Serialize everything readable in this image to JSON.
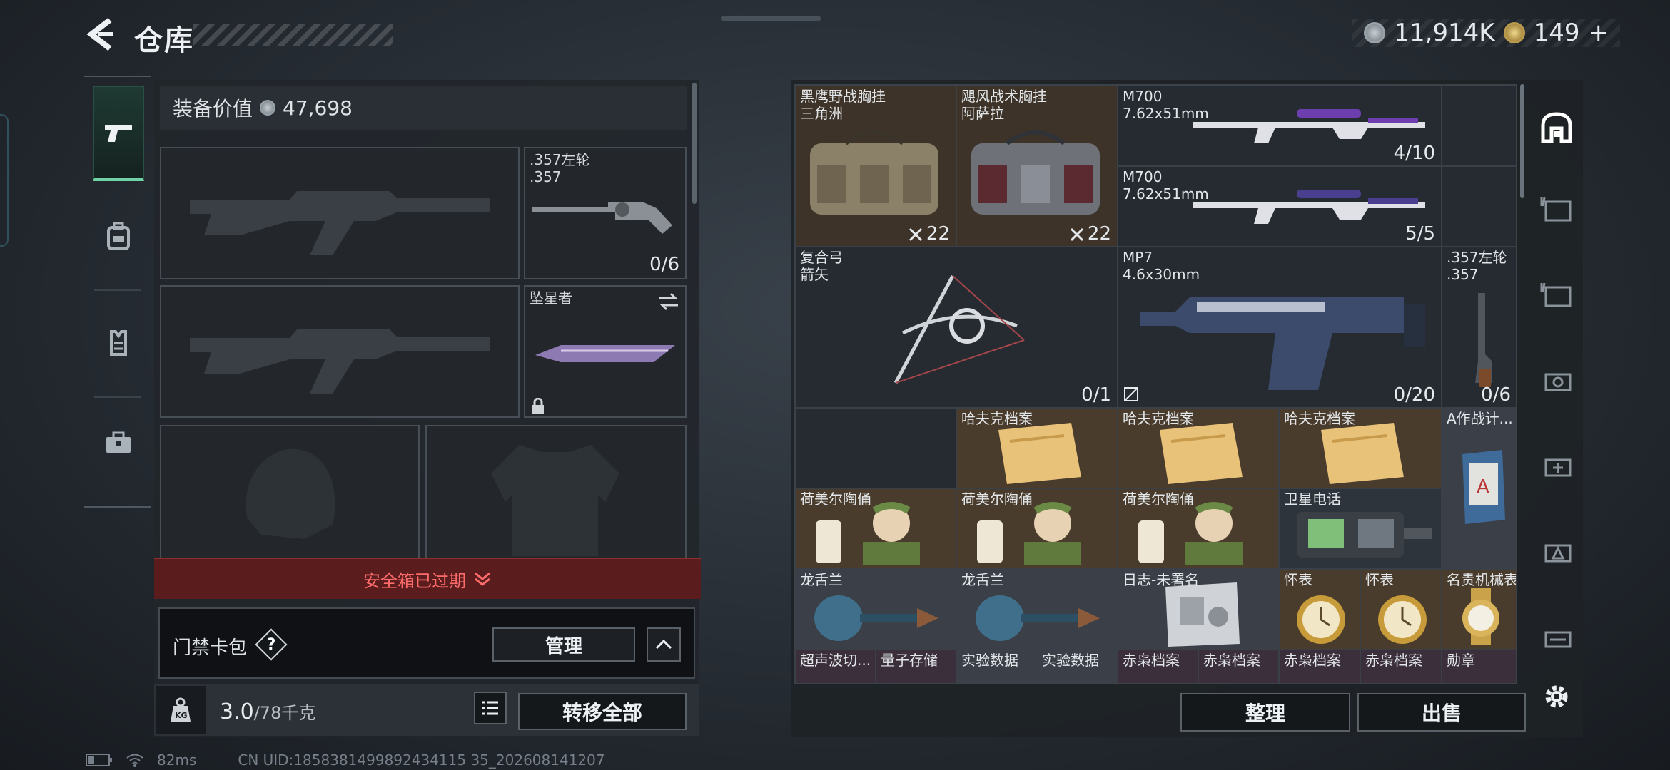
{
  "header": {
    "title": "仓库",
    "coins": "11,914K",
    "tickets": "149",
    "plus": "+"
  },
  "left_panel": {
    "equipment_value_label": "装备价值",
    "equipment_value": "47,698",
    "secondary_slot": {
      "line1": ".357左轮",
      "line2": ".357",
      "count": "0/6"
    },
    "melee_slot": {
      "name": "坠星者"
    },
    "safebox_status": "安全箱已过期",
    "keycard": {
      "label": "门禁卡包",
      "help": "?",
      "manage": "管理"
    },
    "weight": {
      "current": "3.0",
      "max": "/78千克"
    },
    "transfer_all": "转移全部"
  },
  "grid": {
    "cells": [
      {
        "id": "rig1",
        "line1": "黑鹰野战胸挂",
        "line2": "三角洲",
        "count": "22"
      },
      {
        "id": "rig2",
        "line1": "飓风战术胸挂",
        "line2": "阿萨拉",
        "count": "22"
      },
      {
        "id": "m700a",
        "line1": "M700",
        "line2": "7.62x51mm",
        "count": "4/10"
      },
      {
        "id": "m700b",
        "line1": "M700",
        "line2": "7.62x51mm",
        "count": "5/5"
      },
      {
        "id": "bow",
        "line1": "复合弓",
        "line2": "箭矢",
        "count": "0/1"
      },
      {
        "id": "mp7",
        "line1": "MP7",
        "line2": "4.6x30mm",
        "count": "0/20"
      },
      {
        "id": "rev",
        "line1": ".357左轮",
        "line2": ".357",
        "count": "0/6"
      },
      {
        "id": "haf1",
        "line1": "哈夫克档案"
      },
      {
        "id": "haf2",
        "line1": "哈夫克档案"
      },
      {
        "id": "haf3",
        "line1": "哈夫克档案"
      },
      {
        "id": "plan",
        "line1": "A作战计..."
      },
      {
        "id": "fig1",
        "line1": "荷美尔陶俑"
      },
      {
        "id": "fig2",
        "line1": "荷美尔陶俑"
      },
      {
        "id": "fig3",
        "line1": "荷美尔陶俑"
      },
      {
        "id": "phone",
        "line1": "卫星电话"
      },
      {
        "id": "tongue1",
        "line1": "龙舌兰"
      },
      {
        "id": "tongue2",
        "line1": "龙舌兰"
      },
      {
        "id": "log",
        "line1": "日志-未署名"
      },
      {
        "id": "watch1",
        "line1": "怀表"
      },
      {
        "id": "watch2",
        "line1": "怀表"
      },
      {
        "id": "watch3",
        "line1": "名贵机械表"
      },
      {
        "id": "r1",
        "line1": "超声波切..."
      },
      {
        "id": "r2",
        "line1": "量子存储"
      },
      {
        "id": "r3",
        "line1": "实验数据"
      },
      {
        "id": "r4",
        "line1": "实验数据"
      },
      {
        "id": "r5",
        "line1": "赤枭档案"
      },
      {
        "id": "r6",
        "line1": "赤枭档案"
      },
      {
        "id": "r7",
        "line1": "赤枭档案"
      },
      {
        "id": "r8",
        "line1": "赤枭档案"
      },
      {
        "id": "r9",
        "line1": "勋章"
      }
    ],
    "sort_button": "整理",
    "sell_button": "出售"
  },
  "status_bar": {
    "ping": "82ms",
    "uid": "CN UID:1858381499892434115 35_202608141207"
  },
  "colors": {
    "expired_text": "#ff6c6c",
    "active_tab": "#6fd3a5",
    "rare_bg": "#5e4733",
    "purple_bg": "#3f2f4f"
  }
}
